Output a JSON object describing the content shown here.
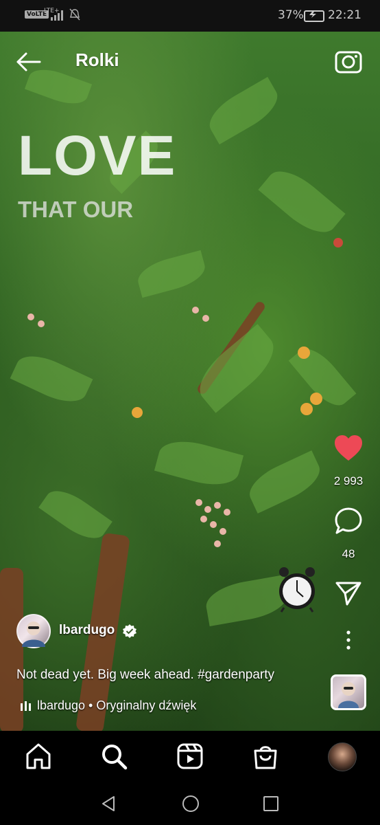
{
  "status_bar": {
    "volte": "VoLTE",
    "lte": "LTE+",
    "battery_percent": "37%",
    "time": "22:21",
    "icons": [
      "signal-icon",
      "bell-off-icon",
      "battery-charging-icon"
    ]
  },
  "header": {
    "title": "Rolki",
    "back_icon": "arrow-left-icon",
    "camera_icon": "camera-icon"
  },
  "video_overlay": {
    "big_text": "LOVE",
    "sub_text": "THAT OUR"
  },
  "actions": {
    "likes": "2 993",
    "comments": "48",
    "like_color": "#ed4956",
    "icons": [
      "heart-icon",
      "comment-icon",
      "share-icon",
      "more-icon"
    ]
  },
  "post": {
    "author": "lbardugo",
    "verified": true,
    "caption": "Not dead yet. Big week ahead. ",
    "hashtag": "#gardenparty",
    "audio": "lbardugo • Oryginalny dźwięk"
  },
  "bottom_nav": {
    "items": [
      "home-icon",
      "search-icon",
      "reels-icon",
      "shop-icon",
      "profile-avatar"
    ],
    "active": "search-icon"
  },
  "android_nav": [
    "back-triangle-icon",
    "home-circle-icon",
    "recents-square-icon"
  ]
}
